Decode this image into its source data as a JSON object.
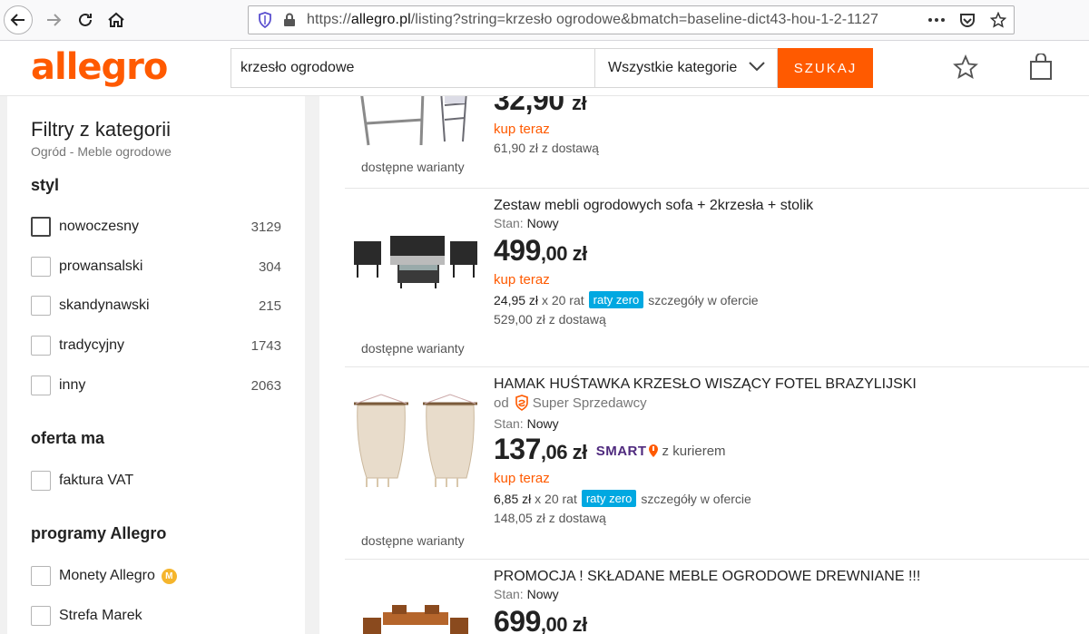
{
  "browser": {
    "url_prefix": "https://",
    "url_domain": "allegro.pl",
    "url_path": "/listing?string=krzesło ogrodowe&bmatch=baseline-dict43-hou-1-2-1127",
    "icons": [
      "back-arrow-icon",
      "forward-arrow-icon",
      "reload-icon",
      "home-icon",
      "shield-icon",
      "lock-icon",
      "more-icon",
      "pocket-icon",
      "bookmark-star-icon"
    ]
  },
  "header": {
    "logo": "allegro",
    "search_value": "krzesło ogrodowe",
    "category": "Wszystkie kategorie",
    "search_button": "SZUKAJ",
    "accent_color": "#ff5a00"
  },
  "sidebar": {
    "title": "Filtry z kategorii",
    "subtitle": "Ogród - Meble ogrodowe",
    "style_heading": "styl",
    "styles": [
      {
        "label": "nowoczesny",
        "count": "3129"
      },
      {
        "label": "prowansalski",
        "count": "304"
      },
      {
        "label": "skandynawski",
        "count": "215"
      },
      {
        "label": "tradycyjny",
        "count": "1743"
      },
      {
        "label": "inny",
        "count": "2063"
      }
    ],
    "offer_heading": "oferta ma",
    "offer_items": [
      {
        "label": "faktura VAT"
      }
    ],
    "programs_heading": "programy Allegro",
    "program_items": [
      {
        "label": "Monety Allegro"
      },
      {
        "label": "Strefa Marek"
      }
    ]
  },
  "listings": [
    {
      "price_main": "32,90",
      "price_currency": "zł",
      "buy_label": "kup teraz",
      "shipping": "61,90 zł z dostawą",
      "variants": "dostępne warianty"
    },
    {
      "title": "Zestaw mebli ogrodowych sofa + 2krzesła + stolik",
      "condition_label": "Stan:",
      "condition_value": "Nowy",
      "price_int": "499",
      "price_dec": ",00 zł",
      "buy_label": "kup teraz",
      "installment_value": "24,95 zł",
      "installment_count": "x 20 rat",
      "installment_badge": "raty zero",
      "installment_details": "szczegóły w ofercie",
      "shipping": "529,00 zł z dostawą",
      "variants": "dostępne warianty"
    },
    {
      "title": "HAMAK HUŚTAWKA KRZESŁO WISZĄCY FOTEL BRAZYLIJSKI",
      "seller_prefix": "od",
      "seller_name": "Super Sprzedawcy",
      "condition_label": "Stan:",
      "condition_value": "Nowy",
      "price_int": "137",
      "price_dec": ",06 zł",
      "smart_label": "SMART",
      "courier_label": "z kurierem",
      "buy_label": "kup teraz",
      "installment_value": "6,85 zł",
      "installment_count": "x 20 rat",
      "installment_badge": "raty zero",
      "installment_details": "szczegóły w ofercie",
      "shipping": "148,05 zł z dostawą",
      "variants": "dostępne warianty"
    },
    {
      "title": "PROMOCJA ! SKŁADANE MEBLE OGRODOWE DREWNIANE !!!",
      "condition_label": "Stan:",
      "condition_value": "Nowy",
      "price_int": "699",
      "price_dec": ",00 zł"
    }
  ]
}
